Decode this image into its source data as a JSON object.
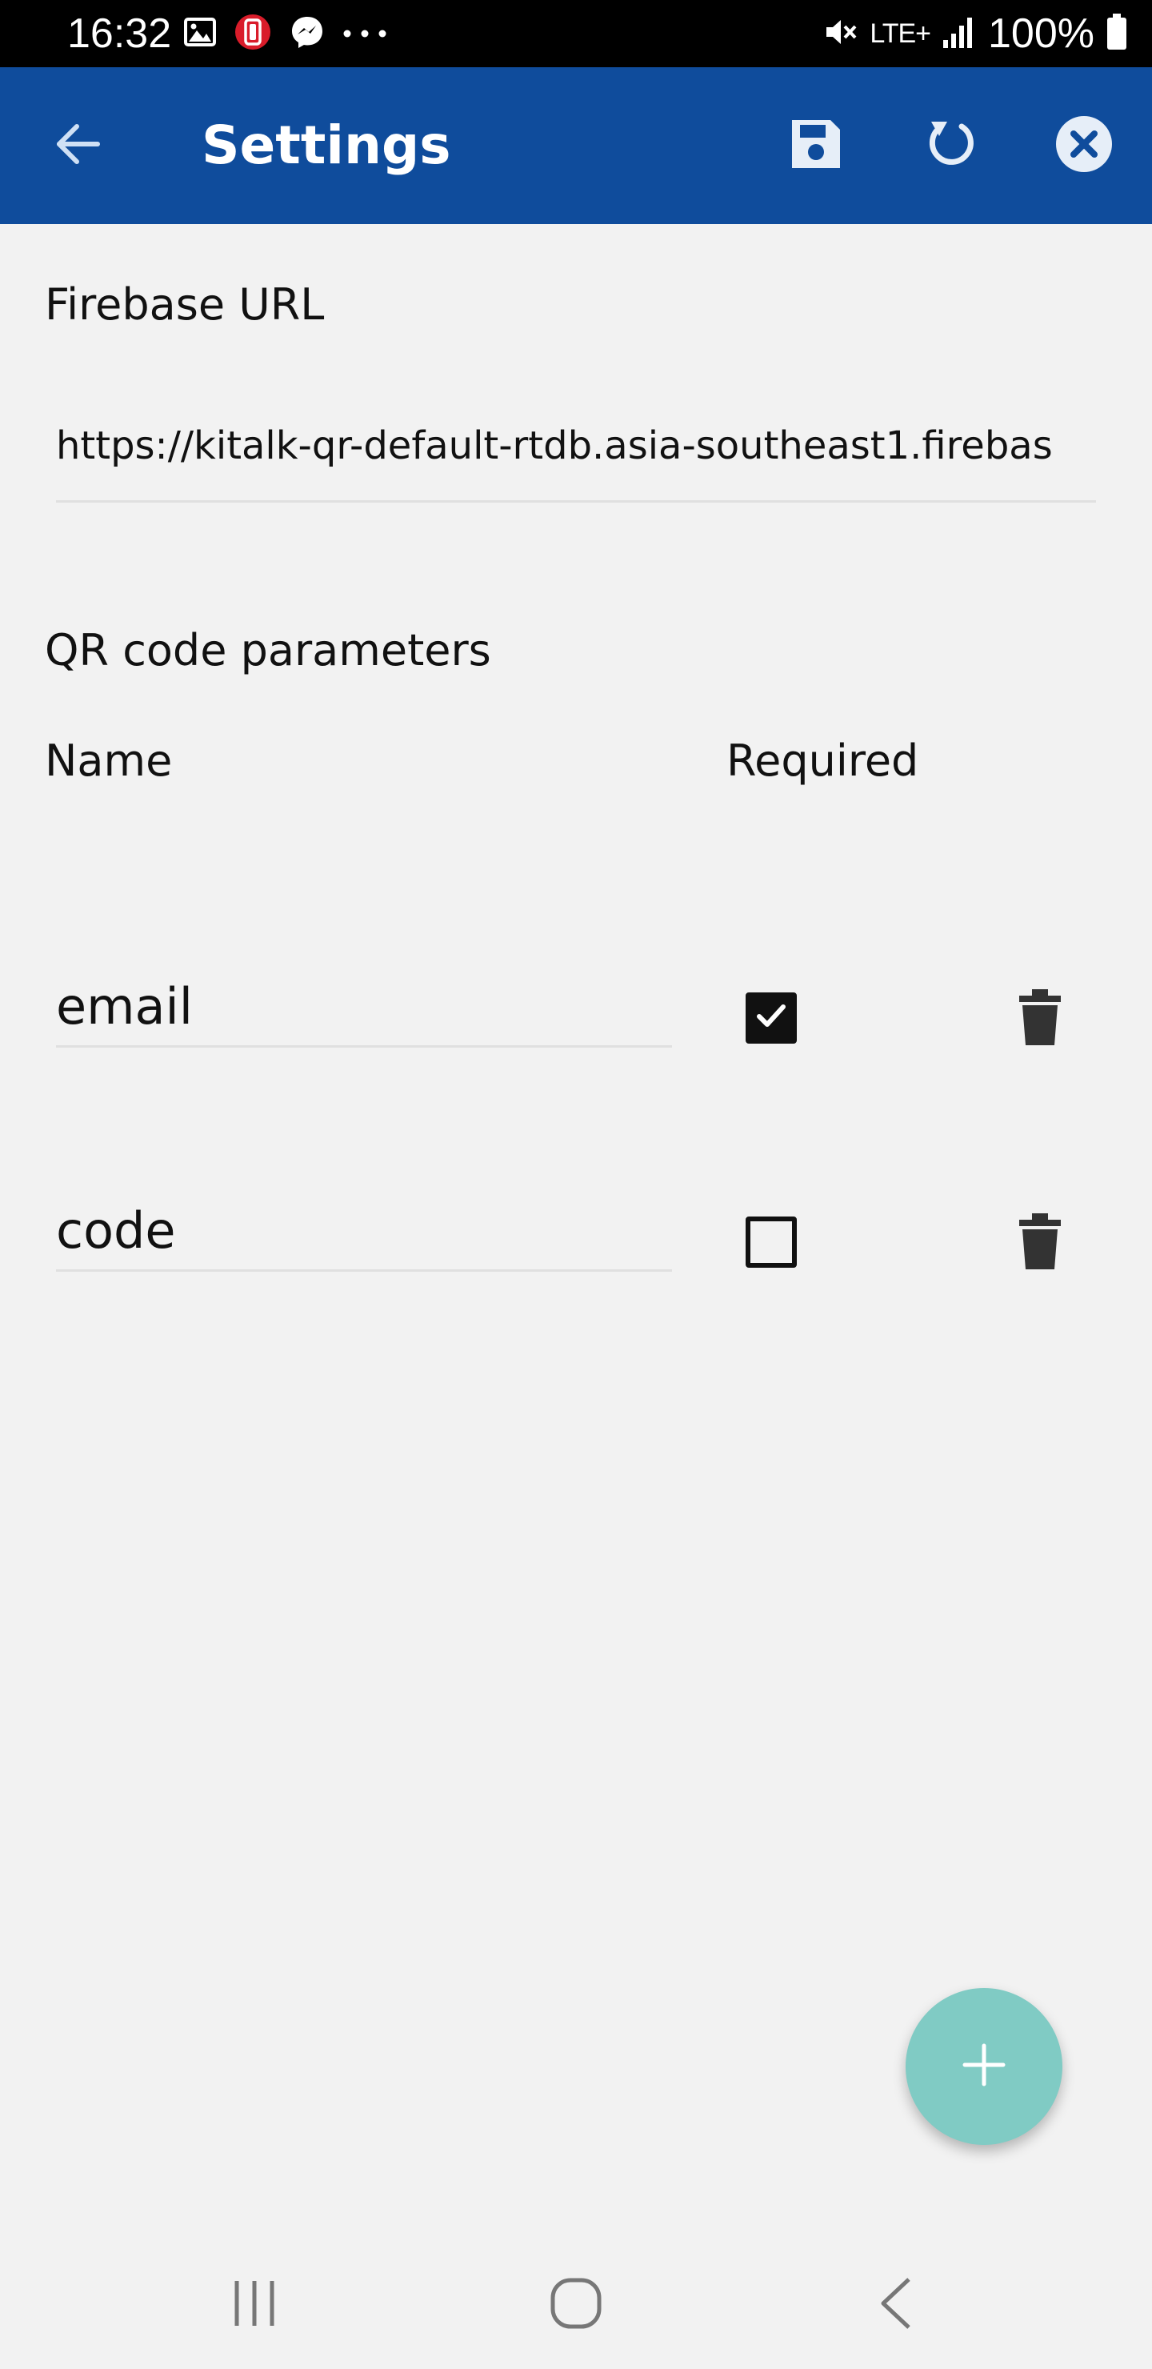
{
  "status_bar": {
    "time": "16:32",
    "network": "LTE+",
    "battery": "100%",
    "left_icons": [
      "image-icon",
      "app-notification-icon",
      "messenger-icon",
      "more-dots-icon"
    ],
    "right_icons": [
      "mute-icon",
      "lte-icon",
      "signal-icon",
      "battery-icon"
    ]
  },
  "app_bar": {
    "title": "Settings",
    "color": "#0f4c9c",
    "actions": [
      "back-arrow-icon",
      "save-icon",
      "refresh-icon",
      "close-icon"
    ]
  },
  "firebase": {
    "label": "Firebase URL",
    "value": "https://kitalk-qr-default-rtdb.asia-southeast1.firebas"
  },
  "params": {
    "section_title": "QR code parameters",
    "col_name": "Name",
    "col_required": "Required",
    "rows": [
      {
        "name": "email",
        "required": true
      },
      {
        "name": "code",
        "required": false
      }
    ]
  },
  "fab": {
    "icon": "plus-icon",
    "color": "#80cbc4"
  },
  "nav_bar": {
    "items": [
      "recents-icon",
      "home-icon",
      "back-icon"
    ]
  }
}
